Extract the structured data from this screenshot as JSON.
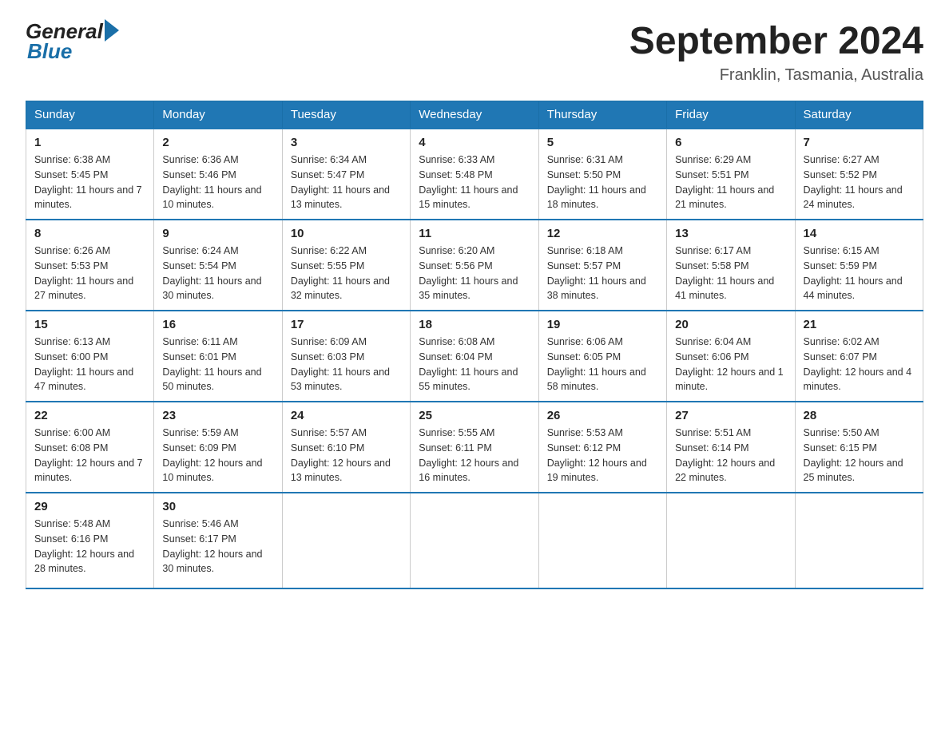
{
  "header": {
    "logo_general": "General",
    "logo_blue": "Blue",
    "title": "September 2024",
    "subtitle": "Franklin, Tasmania, Australia"
  },
  "days_of_week": [
    "Sunday",
    "Monday",
    "Tuesday",
    "Wednesday",
    "Thursday",
    "Friday",
    "Saturday"
  ],
  "weeks": [
    [
      {
        "day": "1",
        "sunrise": "6:38 AM",
        "sunset": "5:45 PM",
        "daylight": "11 hours and 7 minutes."
      },
      {
        "day": "2",
        "sunrise": "6:36 AM",
        "sunset": "5:46 PM",
        "daylight": "11 hours and 10 minutes."
      },
      {
        "day": "3",
        "sunrise": "6:34 AM",
        "sunset": "5:47 PM",
        "daylight": "11 hours and 13 minutes."
      },
      {
        "day": "4",
        "sunrise": "6:33 AM",
        "sunset": "5:48 PM",
        "daylight": "11 hours and 15 minutes."
      },
      {
        "day": "5",
        "sunrise": "6:31 AM",
        "sunset": "5:50 PM",
        "daylight": "11 hours and 18 minutes."
      },
      {
        "day": "6",
        "sunrise": "6:29 AM",
        "sunset": "5:51 PM",
        "daylight": "11 hours and 21 minutes."
      },
      {
        "day": "7",
        "sunrise": "6:27 AM",
        "sunset": "5:52 PM",
        "daylight": "11 hours and 24 minutes."
      }
    ],
    [
      {
        "day": "8",
        "sunrise": "6:26 AM",
        "sunset": "5:53 PM",
        "daylight": "11 hours and 27 minutes."
      },
      {
        "day": "9",
        "sunrise": "6:24 AM",
        "sunset": "5:54 PM",
        "daylight": "11 hours and 30 minutes."
      },
      {
        "day": "10",
        "sunrise": "6:22 AM",
        "sunset": "5:55 PM",
        "daylight": "11 hours and 32 minutes."
      },
      {
        "day": "11",
        "sunrise": "6:20 AM",
        "sunset": "5:56 PM",
        "daylight": "11 hours and 35 minutes."
      },
      {
        "day": "12",
        "sunrise": "6:18 AM",
        "sunset": "5:57 PM",
        "daylight": "11 hours and 38 minutes."
      },
      {
        "day": "13",
        "sunrise": "6:17 AM",
        "sunset": "5:58 PM",
        "daylight": "11 hours and 41 minutes."
      },
      {
        "day": "14",
        "sunrise": "6:15 AM",
        "sunset": "5:59 PM",
        "daylight": "11 hours and 44 minutes."
      }
    ],
    [
      {
        "day": "15",
        "sunrise": "6:13 AM",
        "sunset": "6:00 PM",
        "daylight": "11 hours and 47 minutes."
      },
      {
        "day": "16",
        "sunrise": "6:11 AM",
        "sunset": "6:01 PM",
        "daylight": "11 hours and 50 minutes."
      },
      {
        "day": "17",
        "sunrise": "6:09 AM",
        "sunset": "6:03 PM",
        "daylight": "11 hours and 53 minutes."
      },
      {
        "day": "18",
        "sunrise": "6:08 AM",
        "sunset": "6:04 PM",
        "daylight": "11 hours and 55 minutes."
      },
      {
        "day": "19",
        "sunrise": "6:06 AM",
        "sunset": "6:05 PM",
        "daylight": "11 hours and 58 minutes."
      },
      {
        "day": "20",
        "sunrise": "6:04 AM",
        "sunset": "6:06 PM",
        "daylight": "12 hours and 1 minute."
      },
      {
        "day": "21",
        "sunrise": "6:02 AM",
        "sunset": "6:07 PM",
        "daylight": "12 hours and 4 minutes."
      }
    ],
    [
      {
        "day": "22",
        "sunrise": "6:00 AM",
        "sunset": "6:08 PM",
        "daylight": "12 hours and 7 minutes."
      },
      {
        "day": "23",
        "sunrise": "5:59 AM",
        "sunset": "6:09 PM",
        "daylight": "12 hours and 10 minutes."
      },
      {
        "day": "24",
        "sunrise": "5:57 AM",
        "sunset": "6:10 PM",
        "daylight": "12 hours and 13 minutes."
      },
      {
        "day": "25",
        "sunrise": "5:55 AM",
        "sunset": "6:11 PM",
        "daylight": "12 hours and 16 minutes."
      },
      {
        "day": "26",
        "sunrise": "5:53 AM",
        "sunset": "6:12 PM",
        "daylight": "12 hours and 19 minutes."
      },
      {
        "day": "27",
        "sunrise": "5:51 AM",
        "sunset": "6:14 PM",
        "daylight": "12 hours and 22 minutes."
      },
      {
        "day": "28",
        "sunrise": "5:50 AM",
        "sunset": "6:15 PM",
        "daylight": "12 hours and 25 minutes."
      }
    ],
    [
      {
        "day": "29",
        "sunrise": "5:48 AM",
        "sunset": "6:16 PM",
        "daylight": "12 hours and 28 minutes."
      },
      {
        "day": "30",
        "sunrise": "5:46 AM",
        "sunset": "6:17 PM",
        "daylight": "12 hours and 30 minutes."
      },
      null,
      null,
      null,
      null,
      null
    ]
  ]
}
